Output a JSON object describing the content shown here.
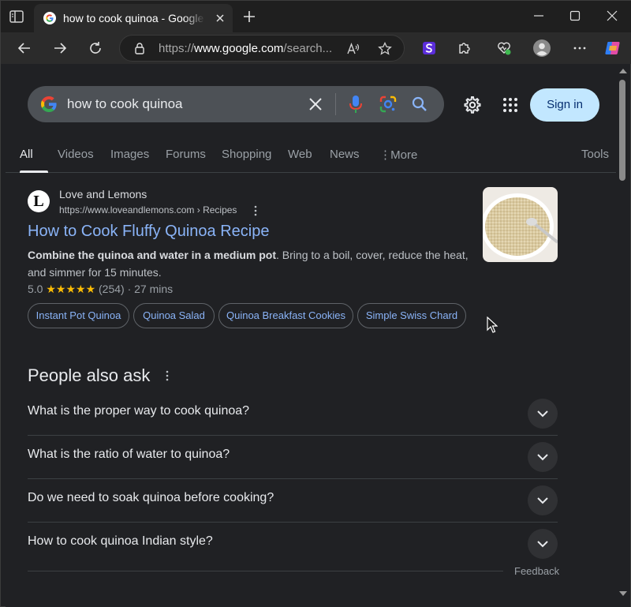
{
  "browser": {
    "tab_title": "how to cook quinoa - Google Search",
    "url_prefix": "https://",
    "url_host": "www.google.com",
    "url_rest": "/search...",
    "icons": [
      "sidebar-toggle-icon",
      "google-favicon",
      "close-icon",
      "plus-icon",
      "minimize-icon",
      "maximize-icon",
      "close-window-icon",
      "back-arrow-icon",
      "forward-arrow-icon",
      "refresh-icon",
      "lock-icon",
      "read-aloud-icon",
      "star-icon",
      "extension-s-icon",
      "puzzle-icon",
      "health-heart-icon",
      "profile-avatar-icon",
      "more-dots-icon",
      "copilot-icon"
    ]
  },
  "search": {
    "query": "how to cook quinoa",
    "sign_in": "Sign in"
  },
  "nav": {
    "items": [
      "All",
      "Videos",
      "Images",
      "Forums",
      "Shopping",
      "Web",
      "News",
      "More"
    ],
    "tools": "Tools",
    "active": "All"
  },
  "result": {
    "favicon_letter": "L",
    "site_name": "Love and Lemons",
    "site_url": "https://www.loveandlemons.com › Recipes",
    "title": "How to Cook Fluffy Quinoa Recipe",
    "snippet_bold": "Combine the quinoa and water in a medium pot",
    "snippet_rest": ". Bring to a boil, cover, reduce the heat, and simmer for 15 minutes.",
    "rating": "5.0",
    "stars": "★★★★★",
    "reviews": "(254)",
    "time": "· 27 mins",
    "chips": [
      "Instant Pot Quinoa",
      "Quinoa Salad",
      "Quinoa Breakfast Cookies",
      "Simple Swiss Chard"
    ]
  },
  "paa": {
    "title": "People also ask",
    "questions": [
      "What is the proper way to cook quinoa?",
      "What is the ratio of water to quinoa?",
      "Do we need to soak quinoa before cooking?",
      "How to cook quinoa Indian style?"
    ],
    "feedback": "Feedback"
  },
  "colors": {
    "link": "#8ab4f8",
    "star": "#fbbc04",
    "sign_in_bg": "#c2e7ff",
    "page_bg": "#202124"
  }
}
